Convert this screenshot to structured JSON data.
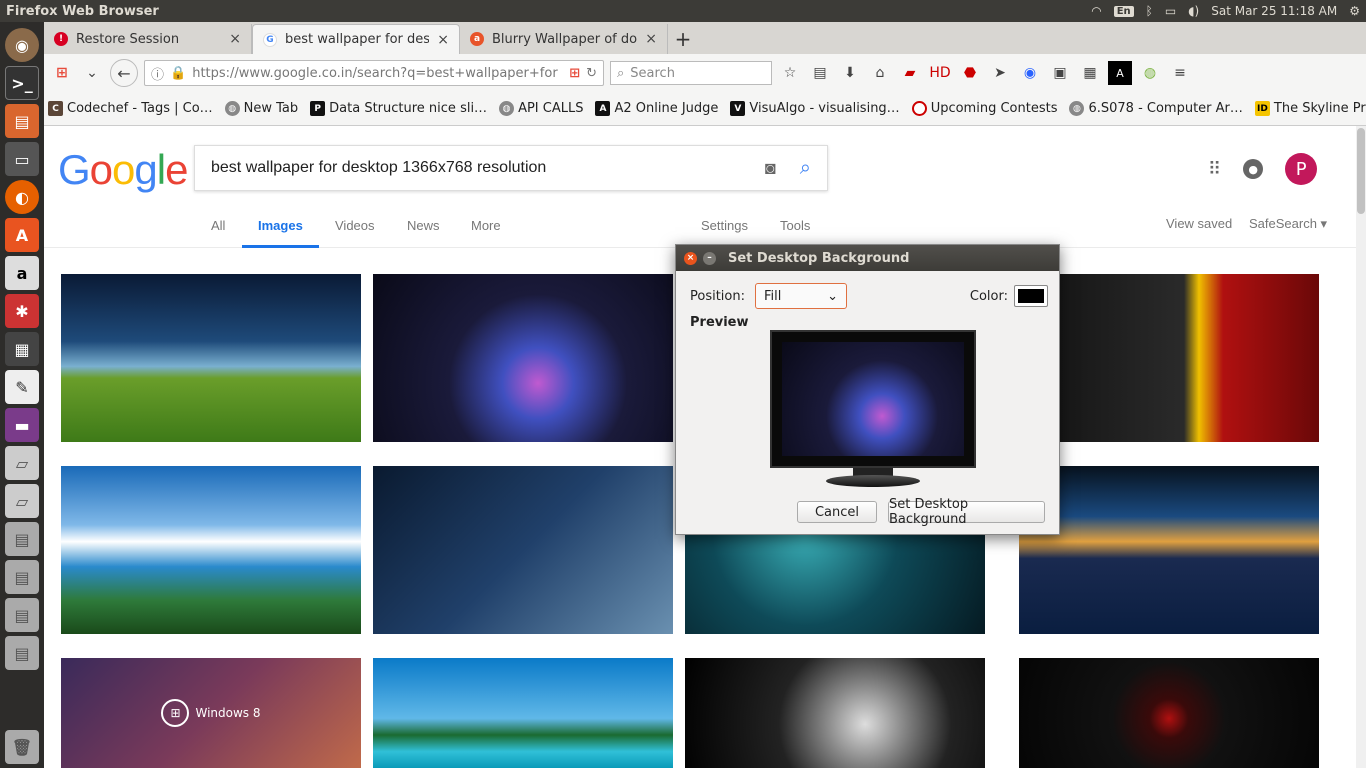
{
  "os": {
    "window_title": "Firefox Web Browser",
    "datetime": "Sat Mar 25 11:18 AM",
    "keyboard": "En"
  },
  "tabs": [
    {
      "title": "Restore Session",
      "close": "×"
    },
    {
      "title": "best wallpaper for des…",
      "close": "×"
    },
    {
      "title": "Blurry Wallpaper of do…",
      "close": "×"
    }
  ],
  "new_tab_label": "+",
  "url": "https://www.google.co.in/search?q=best+wallpaper+for",
  "search": {
    "placeholder": "Search"
  },
  "bookmarks": [
    "Codechef - Tags | Co…",
    "New Tab",
    "Data Structure nice sli…",
    "API CALLS",
    "A2 Online Judge",
    "VisuAlgo - visualising…",
    "Upcoming Contests",
    "6.S078 - Computer Ar…",
    "The Skyline Problem -…"
  ],
  "google": {
    "logo": "Google",
    "query": "best wallpaper for desktop 1366x768 resolution",
    "tabs": [
      "All",
      "Images",
      "Videos",
      "News",
      "More"
    ],
    "active_tab": "Images",
    "settings": "Settings",
    "tools": "Tools",
    "view_saved": "View saved",
    "safesearch": "SafeSearch",
    "avatar_letter": "P",
    "windows8_caption": "Windows 8"
  },
  "dialog": {
    "title": "Set Desktop Background",
    "position_label": "Position:",
    "position_value": "Fill",
    "color_label": "Color:",
    "color_value": "#000000",
    "preview_label": "Preview",
    "cancel": "Cancel",
    "confirm": "Set Desktop Background"
  },
  "colors": {
    "accent": "#1a73e8",
    "ubuntu_panel": "#3c3b37",
    "avatar": "#c2185b"
  }
}
